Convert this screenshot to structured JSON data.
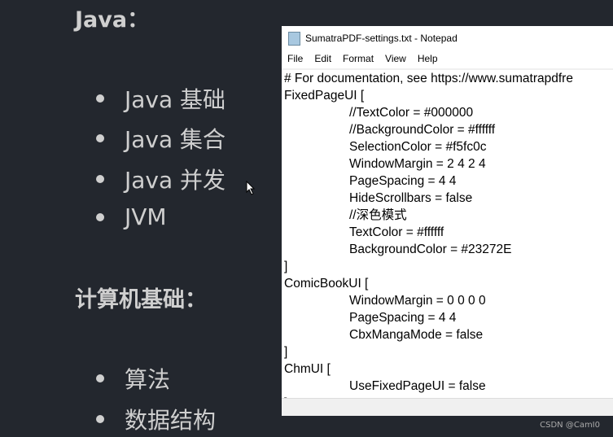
{
  "doc": {
    "heading1": "Java：",
    "list1": [
      "Java 基础",
      "Java 集合",
      "Java 并发",
      "JVM"
    ],
    "heading2": "计算机基础：",
    "list2": [
      "算法",
      "数据结构"
    ]
  },
  "notepad": {
    "title": "SumatraPDF-settings.txt - Notepad",
    "menu": [
      "File",
      "Edit",
      "Format",
      "View",
      "Help"
    ],
    "lines": [
      {
        "t": "# For documentation, see https://www.sumatrapdfre",
        "i": 0
      },
      {
        "t": "FixedPageUI [",
        "i": 0
      },
      {
        "t": "//TextColor = #000000",
        "i": 1
      },
      {
        "t": "//BackgroundColor = #ffffff",
        "i": 1
      },
      {
        "t": "SelectionColor = #f5fc0c",
        "i": 1
      },
      {
        "t": "WindowMargin = 2 4 2 4",
        "i": 1
      },
      {
        "t": "PageSpacing = 4 4",
        "i": 1
      },
      {
        "t": "HideScrollbars = false",
        "i": 1
      },
      {
        "t": "//深色模式",
        "i": 1
      },
      {
        "t": "TextColor = #ffffff",
        "i": 1
      },
      {
        "t": "BackgroundColor = #23272E",
        "i": 1
      },
      {
        "t": "]",
        "i": 0
      },
      {
        "t": "ComicBookUI [",
        "i": 0
      },
      {
        "t": "WindowMargin = 0 0 0 0",
        "i": 1
      },
      {
        "t": "PageSpacing = 4 4",
        "i": 1
      },
      {
        "t": "CbxMangaMode = false",
        "i": 1
      },
      {
        "t": "]",
        "i": 0
      },
      {
        "t": "ChmUI [",
        "i": 0
      },
      {
        "t": "UseFixedPageUI = false",
        "i": 1
      },
      {
        "t": "]",
        "i": 0
      }
    ]
  },
  "watermark": "CSDN @CamI0",
  "colors": {
    "background": "#23272e",
    "text": "#cfcfcf"
  }
}
